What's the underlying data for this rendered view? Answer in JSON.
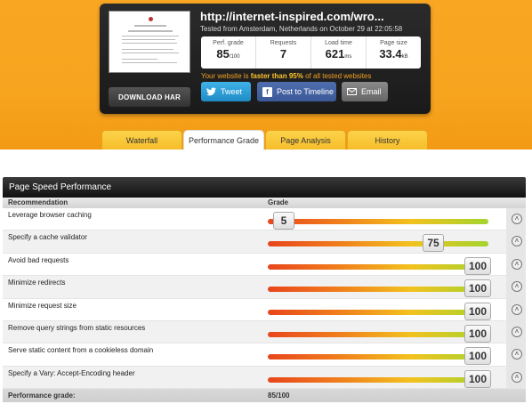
{
  "summary": {
    "url": "http://internet-inspired.com/wro...",
    "tested": "Tested from Amsterdam, Netherlands on October 29 at 22:05:58",
    "download_har": "DOWNLOAD HAR",
    "stats": [
      {
        "label": "Perf. grade",
        "value": "85",
        "unit": "/100"
      },
      {
        "label": "Requests",
        "value": "7",
        "unit": ""
      },
      {
        "label": "Load time",
        "value": "621",
        "unit": "ms"
      },
      {
        "label": "Page size",
        "value": "33.4",
        "unit": "kB"
      }
    ],
    "faster_prefix": "Your website is ",
    "faster_mid": "faster than 95%",
    "faster_suffix": " of all tested websites",
    "buttons": {
      "tweet": "Tweet",
      "facebook": "Post to Timeline",
      "email": "Email"
    }
  },
  "tabs": [
    {
      "label": "Waterfall",
      "active": false
    },
    {
      "label": "Performance Grade",
      "active": true
    },
    {
      "label": "Page Analysis",
      "active": false
    },
    {
      "label": "History",
      "active": false
    }
  ],
  "section": {
    "title": "Page Speed Performance",
    "col_recommendation": "Recommendation",
    "col_grade": "Grade",
    "rows": [
      {
        "name": "Leverage browser caching",
        "grade": 5
      },
      {
        "name": "Specify a cache validator",
        "grade": 75
      },
      {
        "name": "Avoid bad requests",
        "grade": 100
      },
      {
        "name": "Minimize redirects",
        "grade": 100
      },
      {
        "name": "Minimize request size",
        "grade": 100
      },
      {
        "name": "Remove query strings from static resources",
        "grade": 100
      },
      {
        "name": "Serve static content from a cookieless domain",
        "grade": 100
      },
      {
        "name": "Specify a Vary: Accept-Encoding header",
        "grade": 100
      }
    ],
    "footer_label": "Performance grade:",
    "footer_value": "85/100"
  },
  "colors": {
    "accent": "#f7a51f",
    "dark_panel": "#1a1a1a",
    "highlight": "#ffc42a"
  }
}
